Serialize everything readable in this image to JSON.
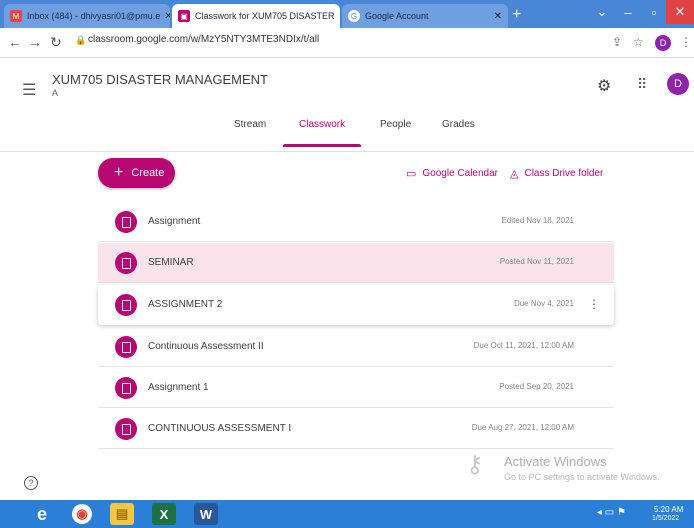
{
  "browser": {
    "tabs": [
      {
        "label": "Inbox (484) - dhivyasri01@pmu.e",
        "close": "✕"
      },
      {
        "label": "Classwork for XUM705 DISASTER",
        "close": "✕"
      },
      {
        "label": "Google Account",
        "close": "✕"
      }
    ],
    "new_tab": "+",
    "url": "classroom.google.com/w/MzY5NTY3MTE3NDIx/t/all",
    "profile_initial": "D"
  },
  "header": {
    "class_title": "XUM705 DISASTER MANAGEMENT",
    "class_section": "A",
    "avatar_initial": "D"
  },
  "nav_tabs": [
    "Stream",
    "Classwork",
    "People",
    "Grades"
  ],
  "toolbar": {
    "create_label": "Create",
    "calendar_link": "Google Calendar",
    "drive_link": "Class Drive folder"
  },
  "items": [
    {
      "title": "Assignment",
      "status": "Edited Nov 18, 2021"
    },
    {
      "title": "SEMINAR",
      "status": "Posted Nov 11, 2021"
    },
    {
      "title": "ASSIGNMENT 2",
      "status": "Due Nov 4, 2021"
    },
    {
      "title": "Continuous Assessment II",
      "status": "Due Oct 11, 2021, 12:00 AM"
    },
    {
      "title": "Assignment 1",
      "status": "Posted Sep 20, 2021"
    },
    {
      "title": "CONTINUOUS ASSESSMENT I",
      "status": "Due Aug 27, 2021, 12:00 AM"
    }
  ],
  "watermark": {
    "title": "Activate Windows",
    "subtitle": "Go to PC settings to activate Windows."
  },
  "taskbar": {
    "time": "5:20 AM",
    "date": "1/5/2022"
  },
  "colors": {
    "accent": "#b80672",
    "highlight_row": "#fbe3ec",
    "taskbar": "#2b7fd6"
  }
}
